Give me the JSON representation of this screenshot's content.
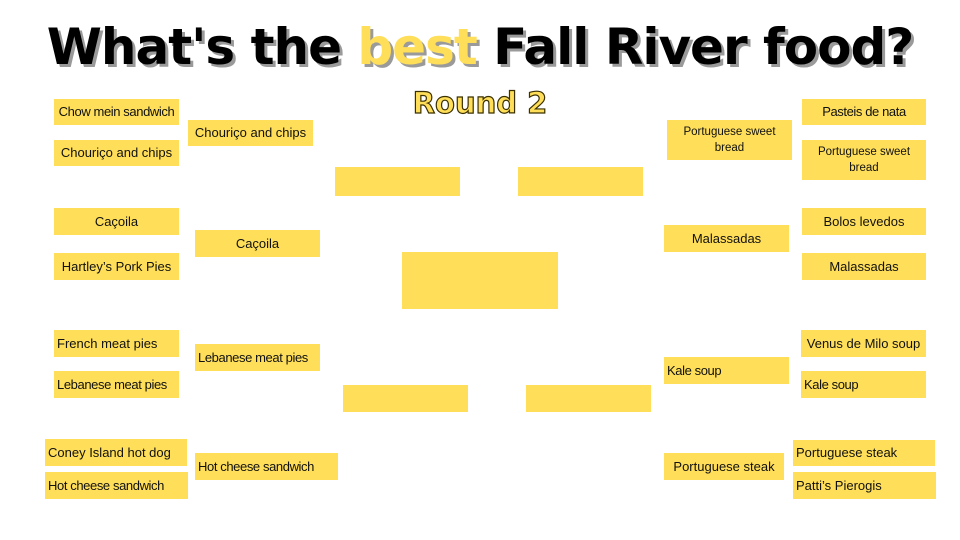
{
  "title": {
    "prefix": "What's the ",
    "accent": "best",
    "suffix": " Fall River food?",
    "accent_color": "#ffde59"
  },
  "subtitle": "Round 2",
  "box_color": "#ffde59",
  "left": {
    "round1": [
      "Chow mein sandwich",
      "Chouriço and chips",
      "Caçoila",
      "Hartley’s Pork Pies",
      "French meat pies",
      "Lebanese meat pies",
      "Coney Island hot dog",
      "Hot cheese sandwich"
    ],
    "round2": [
      "Chouriço and chips",
      "Caçoila",
      "Lebanese meat pies",
      "Hot cheese sandwich"
    ],
    "round3": [
      "",
      ""
    ]
  },
  "right": {
    "round1": [
      "Pasteis de nata",
      "Portuguese sweet bread",
      "Bolos levedos",
      "Malassadas",
      "Venus de Milo soup",
      "Kale soup",
      "Portuguese steak",
      "Patti’s Pierogis"
    ],
    "round2": [
      "Portuguese sweet bread",
      "Malassadas",
      "Kale soup",
      "Portuguese steak"
    ],
    "round3": [
      "",
      ""
    ]
  },
  "final": ""
}
